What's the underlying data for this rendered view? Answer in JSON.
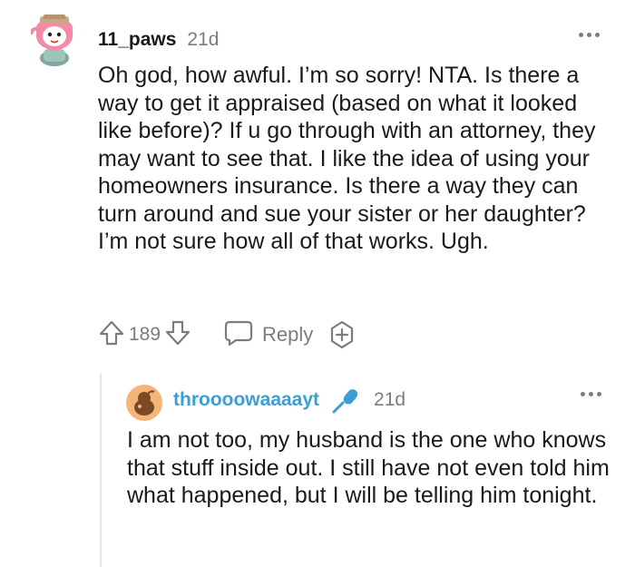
{
  "comment": {
    "username": "11_paws",
    "time": "21d",
    "text": "Oh god, how awful. I’m so sorry! NTA. Is there a way to get it appraised (based on what it looked like before)? If u go through with an attorney, they may want to see that. I like the idea of using your homeowners insurance. Is there a way they can turn around and sue your sister or her daughter? I’m not sure how all of that works. Ugh.",
    "score": "189",
    "reply_label": "Reply",
    "icons": [
      "avatar",
      "more-options-icon",
      "upvote-icon",
      "downvote-icon",
      "reply-bubble-icon",
      "award-plus-icon"
    ]
  },
  "reply": {
    "username": "throooowaaaayt",
    "time": "21d",
    "text": "I am not too, my husband is the one who knows that stuff inside out. I still have not even told him what happened, but I will be telling him tonight.",
    "icons": [
      "avatar",
      "microphone-icon",
      "more-options-icon"
    ]
  },
  "colors": {
    "text": "#1a1a1b",
    "meta": "#7c7c7c",
    "op_username": "#3b9fd6",
    "thread_line": "#e6e6e6"
  }
}
